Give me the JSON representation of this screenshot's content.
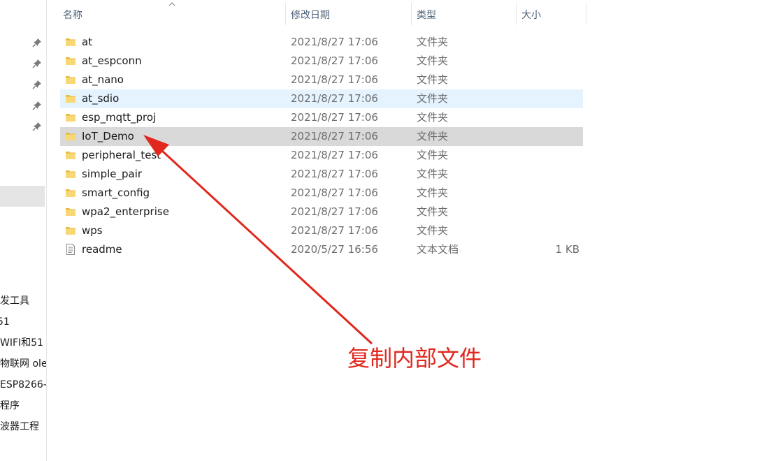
{
  "header": {
    "name": "名称",
    "date": "修改日期",
    "type": "类型",
    "size": "大小"
  },
  "sidebar": {
    "items": [
      {
        "label": "发工具"
      },
      {
        "label": "51"
      },
      {
        "label": "WIFI和51"
      },
      {
        "label": "物联网 ole"
      },
      {
        "label": "ESP8266-"
      },
      {
        "label": "程序"
      },
      {
        "label": "波器工程"
      }
    ]
  },
  "files": [
    {
      "name": "at",
      "date": "2021/8/27 17:06",
      "type": "文件夹",
      "size": "",
      "icon": "folder-icon"
    },
    {
      "name": "at_espconn",
      "date": "2021/8/27 17:06",
      "type": "文件夹",
      "size": "",
      "icon": "folder-icon"
    },
    {
      "name": "at_nano",
      "date": "2021/8/27 17:06",
      "type": "文件夹",
      "size": "",
      "icon": "folder-icon"
    },
    {
      "name": "at_sdio",
      "date": "2021/8/27 17:06",
      "type": "文件夹",
      "size": "",
      "icon": "folder-icon"
    },
    {
      "name": "esp_mqtt_proj",
      "date": "2021/8/27 17:06",
      "type": "文件夹",
      "size": "",
      "icon": "folder-icon"
    },
    {
      "name": "IoT_Demo",
      "date": "2021/8/27 17:06",
      "type": "文件夹",
      "size": "",
      "icon": "folder-icon"
    },
    {
      "name": "peripheral_test",
      "date": "2021/8/27 17:06",
      "type": "文件夹",
      "size": "",
      "icon": "folder-icon"
    },
    {
      "name": "simple_pair",
      "date": "2021/8/27 17:06",
      "type": "文件夹",
      "size": "",
      "icon": "folder-icon"
    },
    {
      "name": "smart_config",
      "date": "2021/8/27 17:06",
      "type": "文件夹",
      "size": "",
      "icon": "folder-icon"
    },
    {
      "name": "wpa2_enterprise",
      "date": "2021/8/27 17:06",
      "type": "文件夹",
      "size": "",
      "icon": "folder-icon"
    },
    {
      "name": "wps",
      "date": "2021/8/27 17:06",
      "type": "文件夹",
      "size": "",
      "icon": "folder-icon"
    },
    {
      "name": "readme",
      "date": "2020/5/27 16:56",
      "type": "文本文档",
      "size": "1 KB",
      "icon": "text-document-icon"
    }
  ],
  "annotation": {
    "text": "复制内部文件",
    "color": "#e0281e"
  },
  "colors": {
    "hover_row": "#e5f3ff",
    "selected_row": "#d9d9d9",
    "header_text": "#4c607a",
    "folder": "#f8d775"
  }
}
